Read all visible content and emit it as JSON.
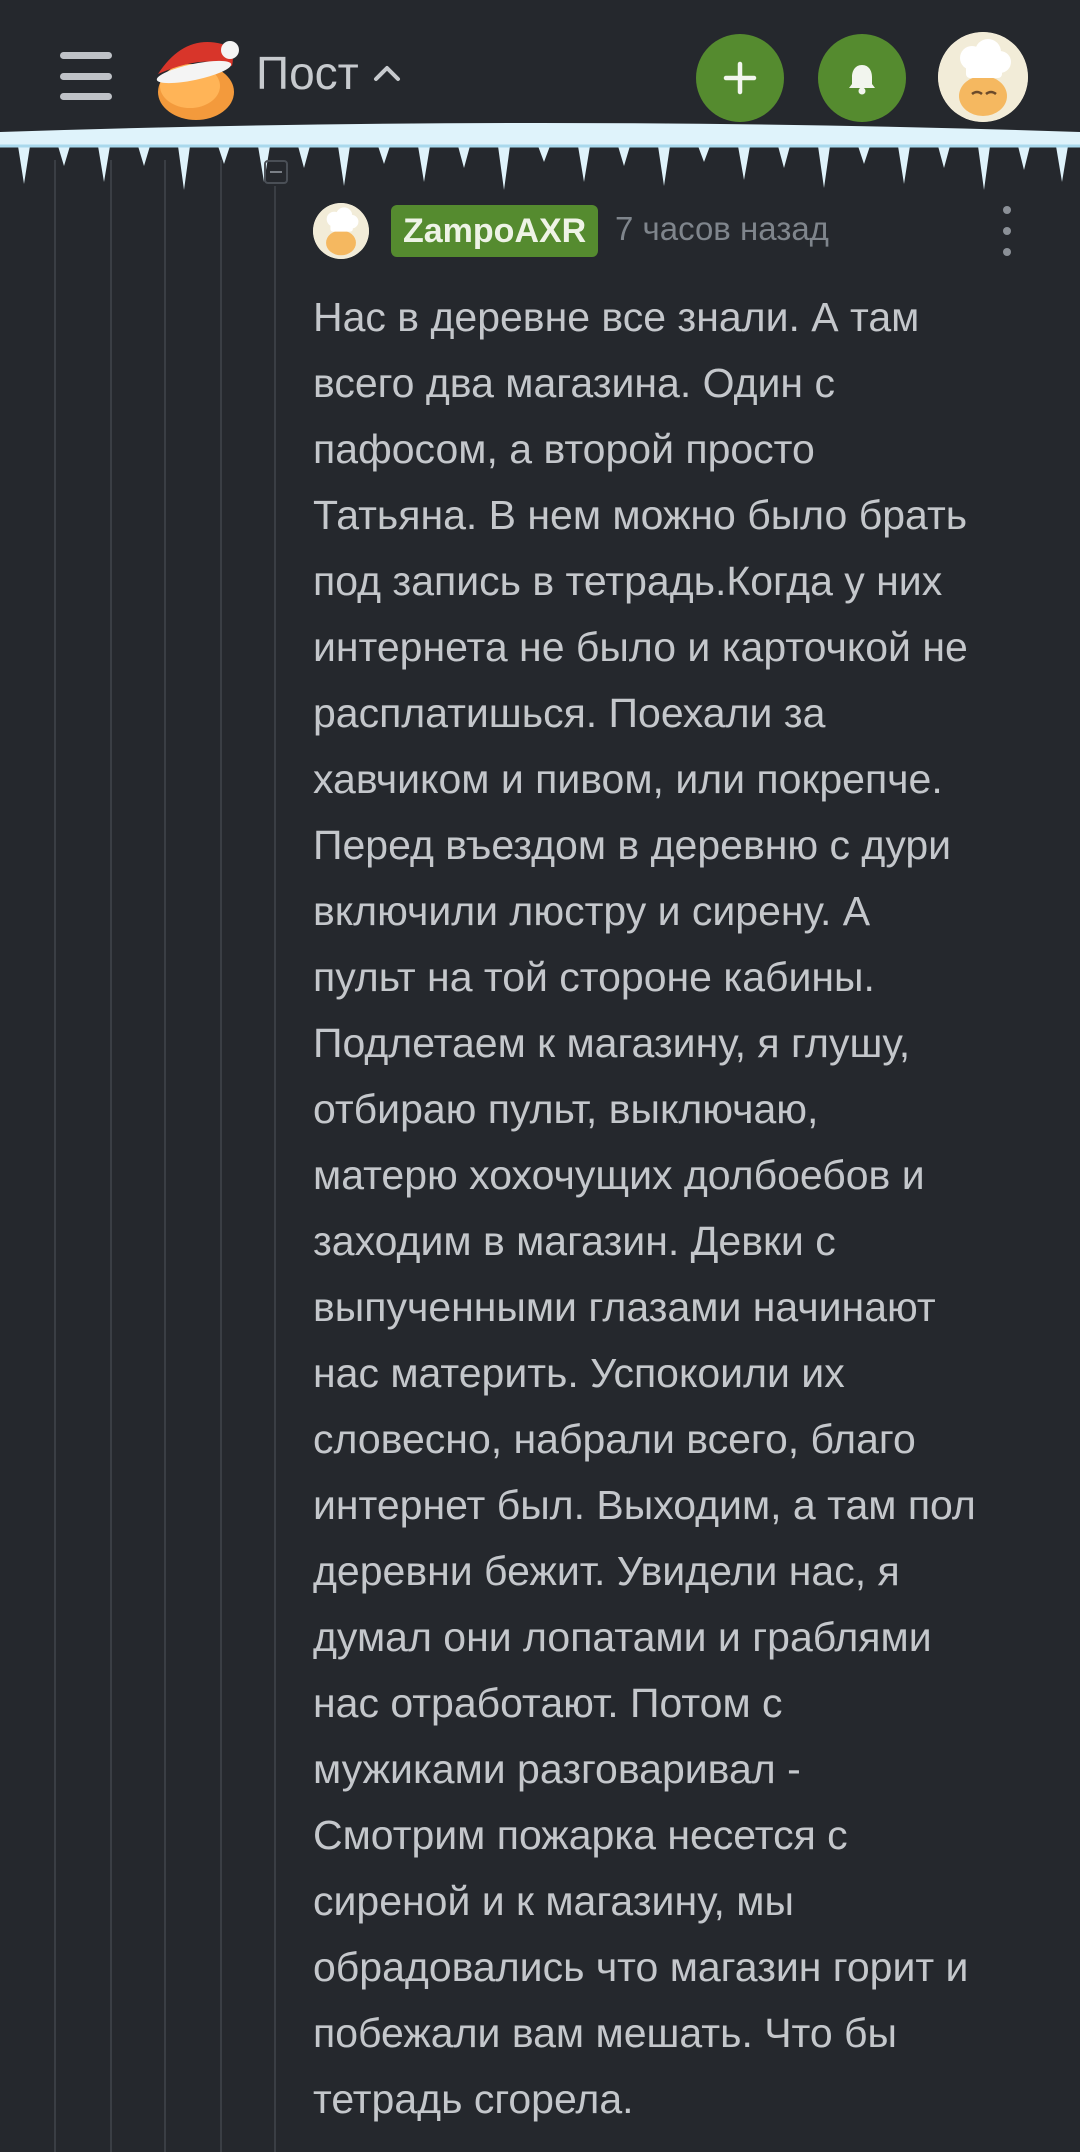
{
  "header": {
    "title": "Пост",
    "icons": {
      "menu": "hamburger-menu-icon",
      "logo": "pikabu-santa-logo",
      "expand": "chevron-up-icon",
      "add": "plus-icon",
      "notifications": "bell-icon",
      "profile": "user-avatar"
    }
  },
  "colors": {
    "background": "#25282d",
    "accent_green": "#558b2f",
    "text": "#c4c7cb",
    "muted": "#7f858c"
  },
  "comment": {
    "username": "ZampoAXR",
    "timestamp": "7 часов назад",
    "text": "Нас в деревне все знали. А там\nвсего два магазина. Один с\nпафосом, а второй просто\nТатьяна. В нем можно было брать\nпод запись в тетрадь.Когда у них\nинтернета не было и карточкой не\nрасплатишься. Поехали за\nхавчиком и пивом, или покрепче.\nПеред въездом в деревню с дури\nвключили люстру и сирену. А\nпульт на той стороне кабины.\nПодлетаем к магазину, я глушу,\nотбираю пульт, выключаю,\nматерю хохочущих долбоебов и\nзаходим в магазин. Девки с\nвыпученными глазами начинают\nнас материть. Успокоили их\nсловесно, набрали всего, благо\nинтернет был. Выходим, а там пол\nдеревни бежит. Увидели нас, я\nдумал они лопатами и граблями\nнас отработают. Потом с\nмужиками разговаривал -\nСмотрим пожарка несется с\nсиреной и к магазину, мы\nобрадовались что магазин горит и\nпобежали вам мешать. Что бы\nтетрадь сгорела."
  }
}
